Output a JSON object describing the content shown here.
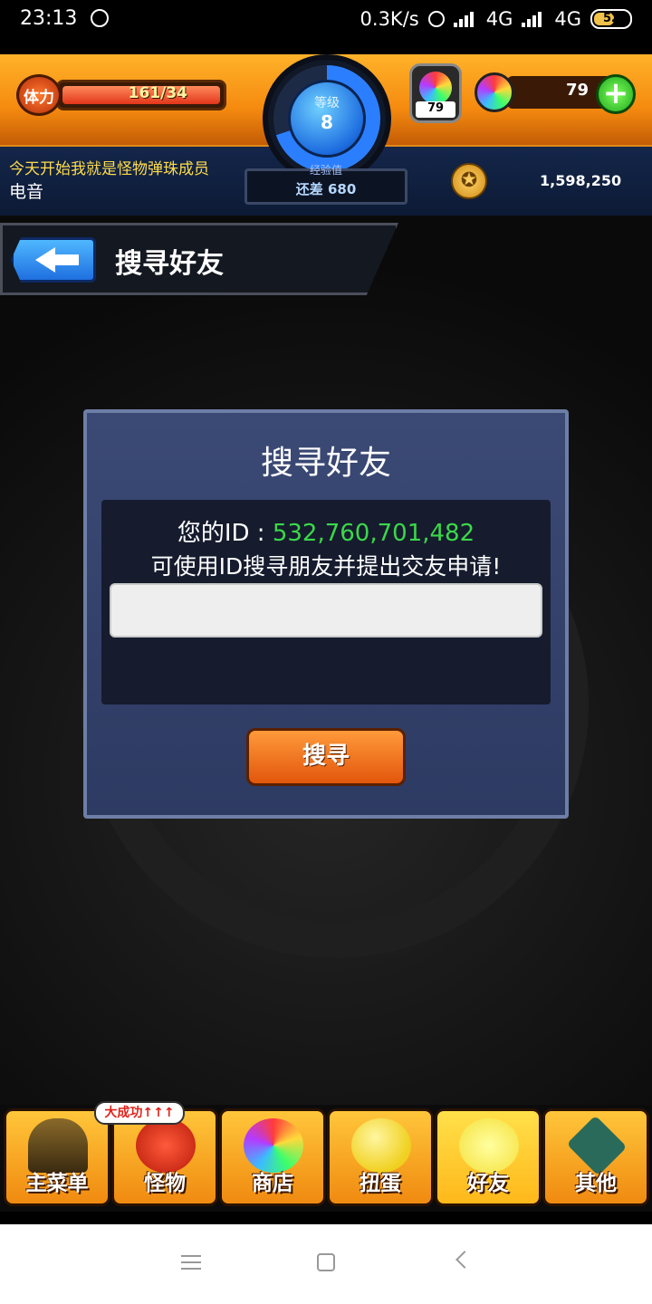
{
  "status_bar": {
    "time": "23:13",
    "network_speed": "0.3K/s",
    "network1": "4G",
    "network2": "4G",
    "battery": "52"
  },
  "hud": {
    "stamina_label": "体力",
    "stamina_value": "161/34",
    "rank_label": "等级",
    "rank_value": "8",
    "exp_label": "经验值",
    "exp_value": "还差 680",
    "potion_count": "79",
    "gem_count": "79",
    "gold": "1,598,250",
    "news_line1": "今天开始我就是怪物弹珠成员",
    "news_line2": "电音"
  },
  "header": {
    "title": "搜寻好友"
  },
  "dialog": {
    "title": "搜寻好友",
    "id_label": "您的ID :",
    "id_value": "532,760,701,482",
    "hint": "可使用ID搜寻朋友并提出交友申请!",
    "input_value": "",
    "search_label": "搜寻"
  },
  "nav": {
    "badge": "大成功↑↑↑",
    "tabs": [
      {
        "label": "主菜单",
        "icon": "home-gate-icon"
      },
      {
        "label": "怪物",
        "icon": "monster-icon"
      },
      {
        "label": "商店",
        "icon": "rainbow-orb-icon"
      },
      {
        "label": "扭蛋",
        "icon": "egg-icon"
      },
      {
        "label": "好友",
        "icon": "friends-icon"
      },
      {
        "label": "其他",
        "icon": "other-icon"
      }
    ]
  },
  "colors": {
    "accent_orange": "#f58a0f",
    "id_green": "#3bd84a",
    "dialog_bg": "#2d3a62"
  }
}
